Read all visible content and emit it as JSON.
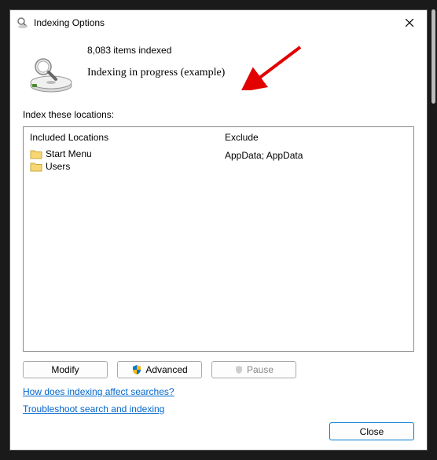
{
  "window": {
    "title": "Indexing Options"
  },
  "status": {
    "count_line": "8,083 items indexed",
    "progress_line": "Indexing in progress (example)"
  },
  "section_label": "Index these locations:",
  "columns": {
    "included_header": "Included Locations",
    "exclude_header": "Exclude"
  },
  "locations": [
    {
      "name": "Start Menu",
      "exclude": ""
    },
    {
      "name": "Users",
      "exclude": "AppData; AppData"
    }
  ],
  "buttons": {
    "modify": "Modify",
    "advanced": "Advanced",
    "pause": "Pause",
    "close": "Close"
  },
  "links": {
    "affect": "How does indexing affect searches?",
    "troubleshoot": "Troubleshoot search and indexing"
  }
}
